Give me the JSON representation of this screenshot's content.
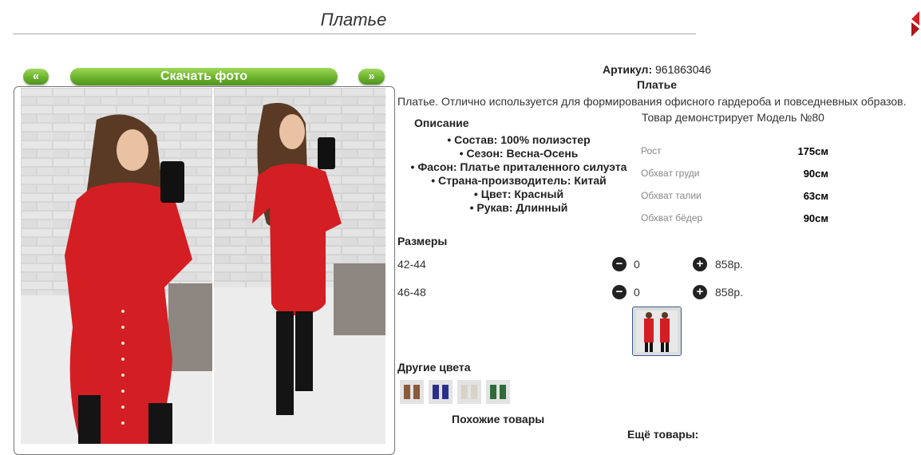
{
  "page": {
    "title": "Платье",
    "download_label": "Скачать фото",
    "prev_label": "«",
    "next_label": "»"
  },
  "product": {
    "article_label": "Артикул:",
    "article_value": "961863046",
    "name": "Платье",
    "description": "Платье. Отлично используется для формирования офисного гардероба и повседневных образов.",
    "description_title": "Описание",
    "description_items": [
      "Состав: 100% полиэстер",
      "Сезон: Весна-Осень",
      "Фасон: Платье приталенного силуэта",
      "Страна-производитель: Китай",
      "Цвет: Красный",
      "Рукав: Длинный"
    ]
  },
  "model": {
    "note": "Товар демонстрирует Модель №80",
    "measurements": [
      {
        "name": "Рост",
        "value": "175см"
      },
      {
        "name": "Обхват груди",
        "value": "90см"
      },
      {
        "name": "Обхват талии",
        "value": "63см"
      },
      {
        "name": "Обхват бёдер",
        "value": "90см"
      }
    ]
  },
  "sizes": {
    "title": "Размеры",
    "minus_symbol": "−",
    "plus_symbol": "+",
    "rows": [
      {
        "label": "42-44",
        "qty": "0",
        "price": "858р."
      },
      {
        "label": "46-48",
        "qty": "0",
        "price": "858р."
      }
    ]
  },
  "colors": {
    "title": "Другие цвета",
    "swatches": [
      "#8a5a3a",
      "#2b2f8c",
      "#d9d2c6",
      "#2f6b3a",
      "#7a2c34"
    ]
  },
  "footer": {
    "similar_title": "Похожие товары",
    "more_title": "Ещё товары:"
  },
  "theme": {
    "dress_color": "#d31e24",
    "button_green": "#6cb32c",
    "brick_color": "#d4d4d4"
  },
  "icons": {
    "corner": "red-chevron-icon",
    "minus": "minus-circle-icon",
    "plus": "plus-circle-icon"
  }
}
